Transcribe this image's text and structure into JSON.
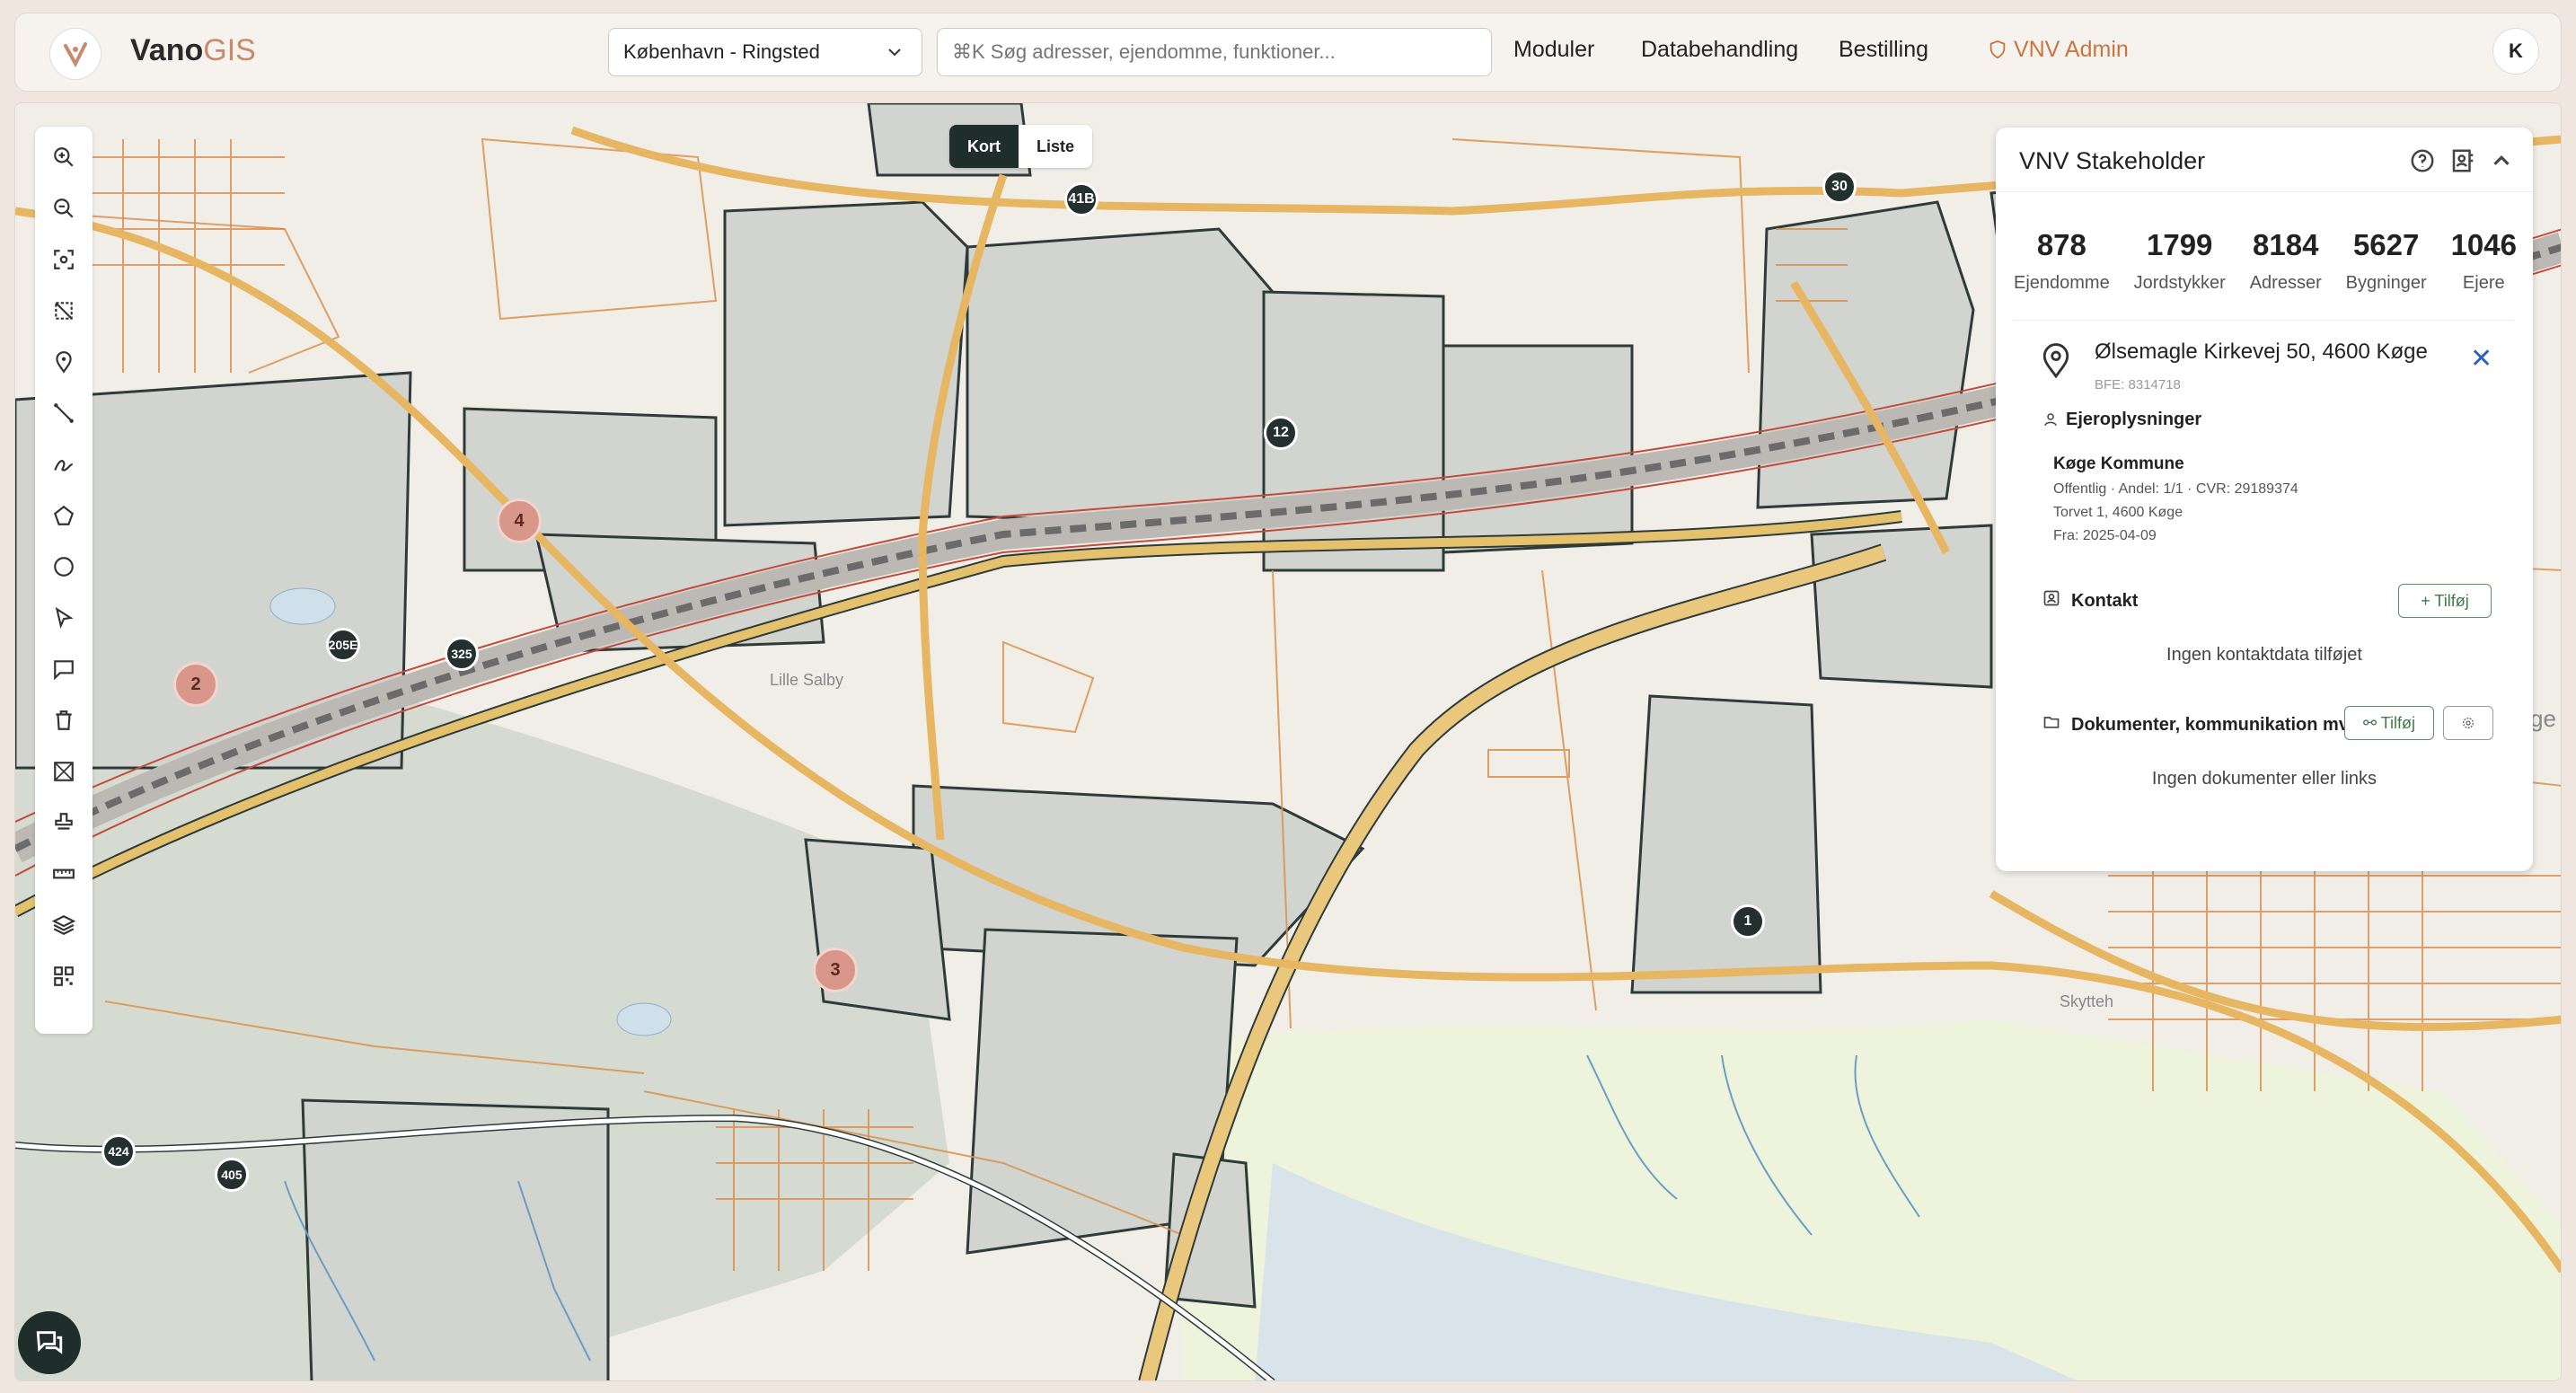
{
  "app": {
    "logo_main": "Vano",
    "logo_accent": "GIS"
  },
  "header": {
    "region": "København - Ringsted",
    "search_placeholder": "⌘K Søg adresser, ejendomme, funktioner...",
    "nav": {
      "moduler": "Moduler",
      "databehandling": "Databehandling",
      "bestilling": "Bestilling",
      "admin": "VNV Admin"
    },
    "avatar": "K"
  },
  "map": {
    "toggle": {
      "kort": "Kort",
      "liste": "Liste"
    },
    "markers": {
      "m41B": "41B",
      "m30": "30",
      "m12": "12",
      "m4": "4",
      "m2": "2",
      "m205E": "205E",
      "m325": "325",
      "m3": "3",
      "m1": "1",
      "m424": "424",
      "m405": "405"
    },
    "place_labels": {
      "lille_salby": "Lille Salby",
      "skytteh": "Skytteh",
      "ge": "ge"
    }
  },
  "panel": {
    "title": "VNV Stakeholder",
    "stats": [
      {
        "value": "878",
        "label": "Ejendomme"
      },
      {
        "value": "1799",
        "label": "Jordstykker"
      },
      {
        "value": "8184",
        "label": "Adresser"
      },
      {
        "value": "5627",
        "label": "Bygninger"
      },
      {
        "value": "1046",
        "label": "Ejere"
      }
    ],
    "address": "Ølsemagle Kirkevej 50, 4600 Køge",
    "bfe": "BFE: 8314718",
    "owner_section": "Ejeroplysninger",
    "owner_name": "Køge Kommune",
    "owner_line1": "Offentlig · Andel: 1/1 · CVR: 29189374",
    "owner_line2": "Torvet 1, 4600 Køge",
    "owner_line3": "Fra: 2025-04-09",
    "contact_section": "Kontakt",
    "contact_add": "+ Tilføj",
    "contact_empty": "Ingen kontaktdata tilføjet",
    "docs_section": "Dokumenter, kommunikation mv.",
    "docs_add": "⚯ Tilføj",
    "docs_empty": "Ingen dokumenter eller links"
  },
  "colors": {
    "accent": "#c8763f",
    "dark": "#23302e",
    "parcel": "#cfd3cf",
    "road": "#e8c47a"
  }
}
